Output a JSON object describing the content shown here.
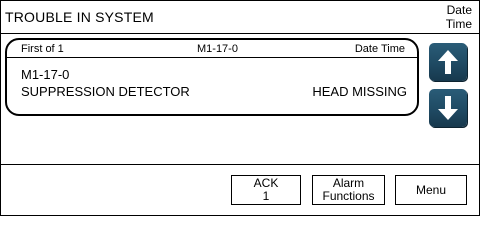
{
  "header": {
    "title": "TROUBLE IN SYSTEM",
    "date_line1": "Date",
    "date_line2": "Time"
  },
  "event_list": {
    "position": "First of 1",
    "address": "M1-17-0",
    "date_time_label": "Date Time"
  },
  "event": {
    "address": "M1-17-0",
    "device": "SUPPRESSION DETECTOR",
    "status": "HEAD MISSING"
  },
  "nav": {
    "up_icon": "arrow-up-icon",
    "down_icon": "arrow-down-icon",
    "color": "#1f4a63"
  },
  "buttons": {
    "ack_line1": "ACK",
    "ack_line2": "1",
    "alarm_line1": "Alarm",
    "alarm_line2": "Functions",
    "menu": "Menu"
  }
}
